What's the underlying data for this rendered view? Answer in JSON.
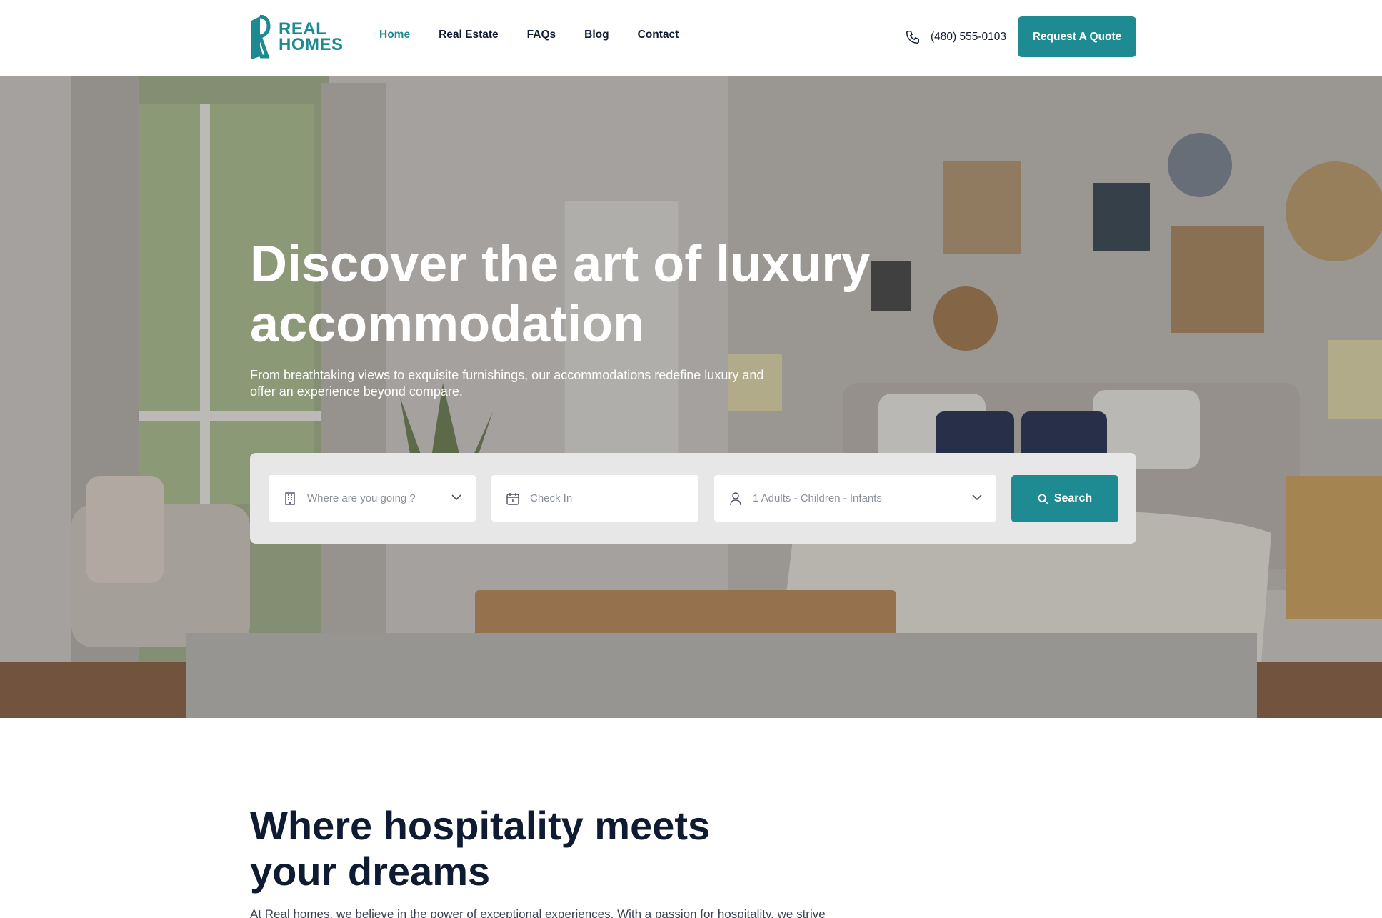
{
  "brand": {
    "line1": "REAL",
    "line2": "HOMES",
    "color": "#1d8a93"
  },
  "nav": [
    {
      "label": "Home",
      "active": true
    },
    {
      "label": "Real Estate",
      "active": false
    },
    {
      "label": "FAQs",
      "active": false
    },
    {
      "label": "Blog",
      "active": false
    },
    {
      "label": "Contact",
      "active": false
    }
  ],
  "header": {
    "phone": "(480) 555-0103",
    "phone_icon": "phone-icon",
    "cta_label": "Request A Quote"
  },
  "hero": {
    "title": "Discover the art of luxury accommodation",
    "subtitle": "From breathtaking views to exquisite furnishings, our accommodations redefine luxury and offer an experience beyond compare."
  },
  "search": {
    "destination_placeholder": "Where are you going ?",
    "checkin_placeholder": "Check In",
    "guests_placeholder": "1 Adults - Children - Infants",
    "button_label": "Search",
    "icons": [
      "building-icon",
      "calendar-icon",
      "user-icon",
      "search-icon",
      "chevron-down-icon"
    ]
  },
  "about": {
    "title": "Where hospitality meets your dreams",
    "text": "At Real homes, we believe in the power of exceptional experiences. With a passion for hospitality, we strive"
  },
  "colors": {
    "accent": "#1e8a92",
    "dark_text": "#0f1b33"
  }
}
